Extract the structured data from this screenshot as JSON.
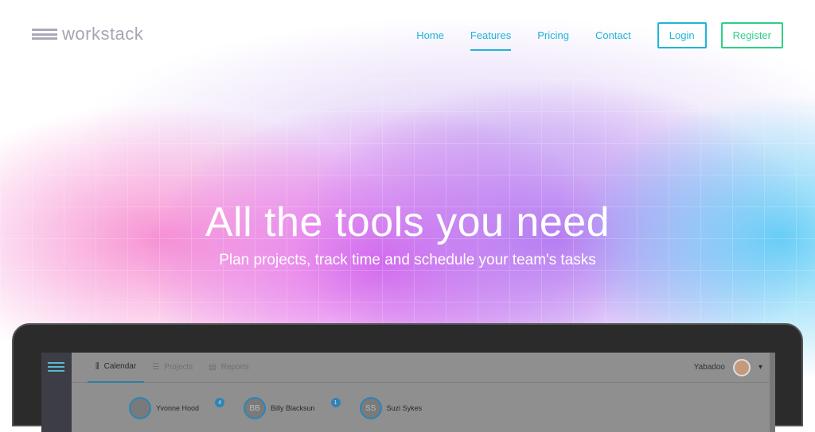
{
  "brand": {
    "name": "workstack"
  },
  "nav": {
    "items": [
      {
        "label": "Home"
      },
      {
        "label": "Features",
        "active": true
      },
      {
        "label": "Pricing"
      },
      {
        "label": "Contact"
      }
    ],
    "login": "Login",
    "register": "Register"
  },
  "hero": {
    "title": "All the tools you need",
    "subtitle": "Plan projects, track time and schedule your team's tasks"
  },
  "app": {
    "tabs": [
      "Calendar",
      "Projects",
      "Reports"
    ],
    "user": "Yabadoo",
    "people": [
      {
        "name": "Yvonne Hood",
        "initials": "",
        "badge": "4"
      },
      {
        "name": "Billy Blacksun",
        "initials": "BB",
        "badge": "1"
      },
      {
        "name": "Suzi Sykes",
        "initials": "SS",
        "badge": ""
      }
    ]
  },
  "colors": {
    "accent": "#1fb4d8",
    "register": "#2ecf85"
  }
}
